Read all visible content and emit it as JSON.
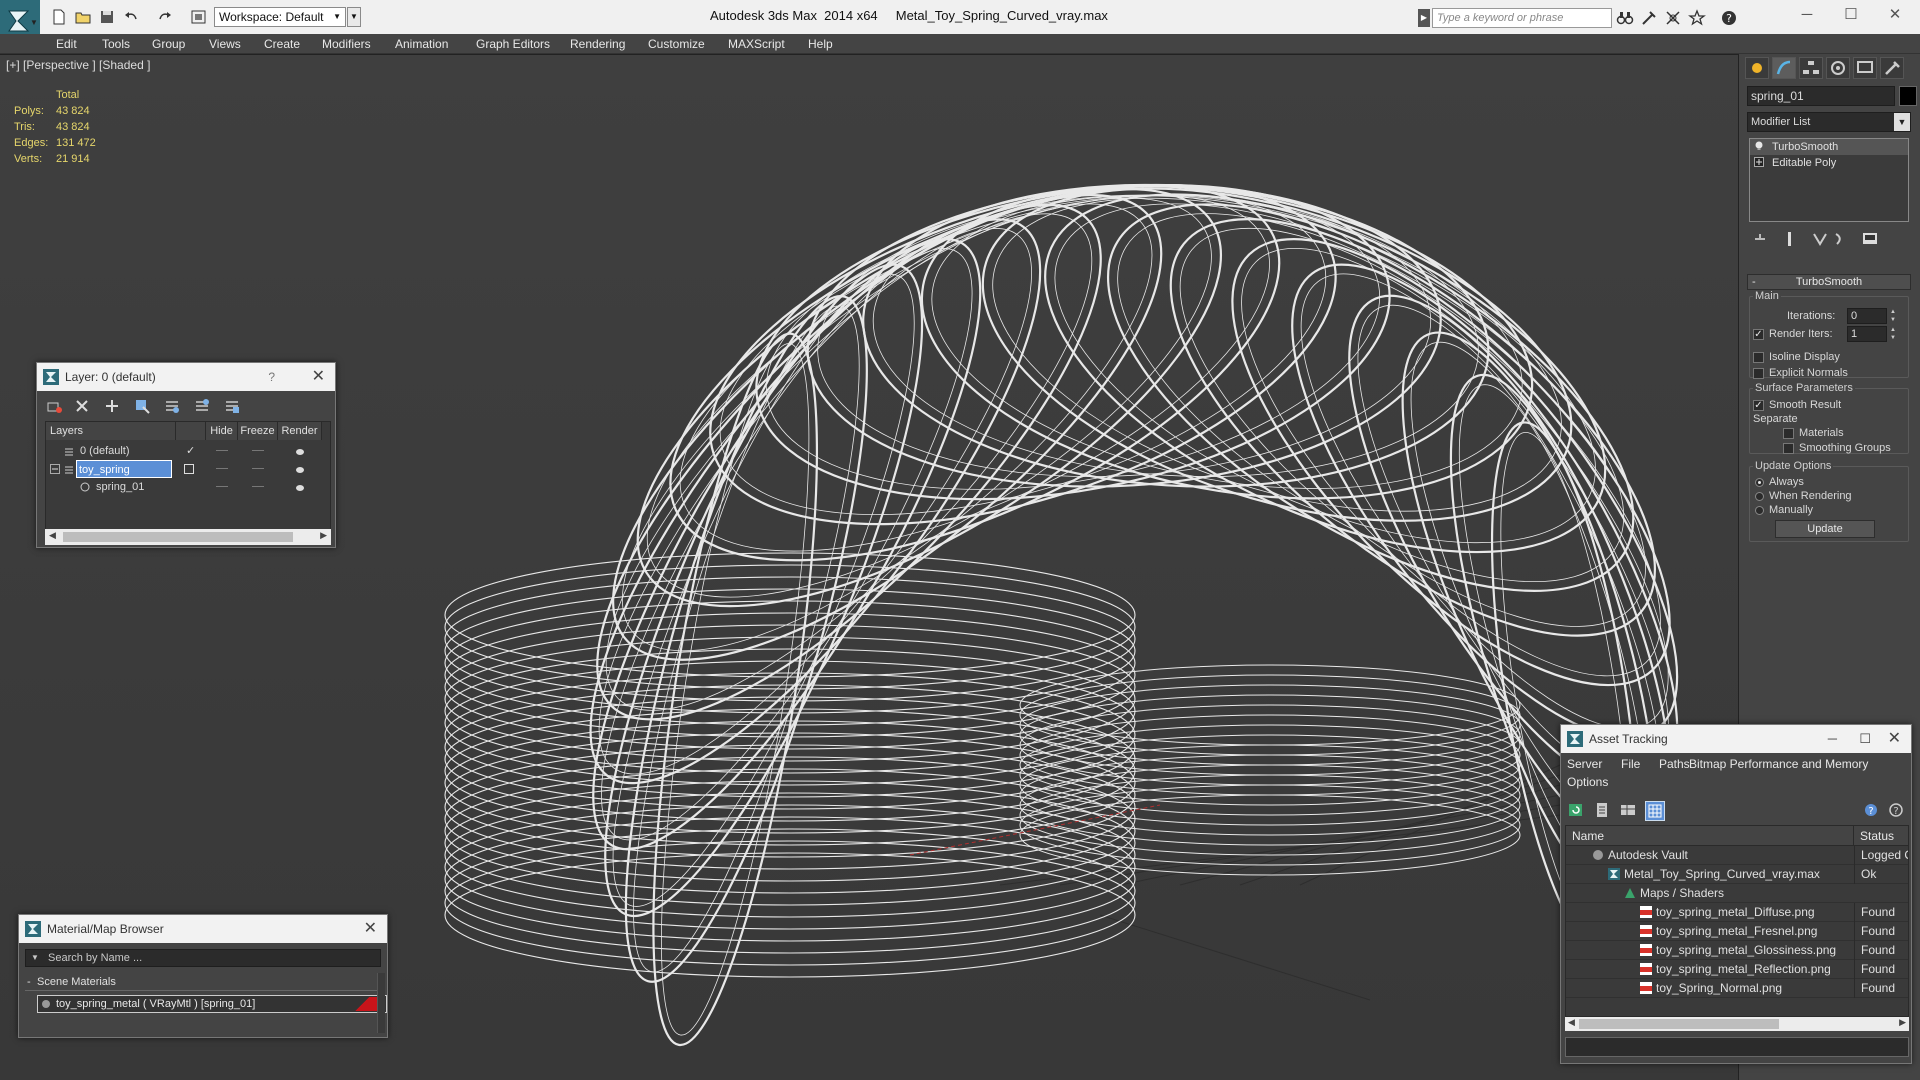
{
  "titlebar": {
    "workspace": "Workspace: Default",
    "app_name": "Autodesk 3ds Max  2014 x64",
    "file_name": "Metal_Toy_Spring_Curved_vray.max",
    "search_placeholder": "Type a keyword or phrase"
  },
  "menu": [
    "Edit",
    "Tools",
    "Group",
    "Views",
    "Create",
    "Modifiers",
    "Animation",
    "Graph Editors",
    "Rendering",
    "Customize",
    "MAXScript",
    "Help"
  ],
  "viewport": {
    "label": "[+] [Perspective ] [Shaded ]",
    "stats": {
      "header": "Total",
      "rows": [
        {
          "label": "Polys:",
          "value": "43 824"
        },
        {
          "label": "Tris:",
          "value": "43 824"
        },
        {
          "label": "Edges:",
          "value": "131 472"
        },
        {
          "label": "Verts:",
          "value": "21 914"
        }
      ]
    }
  },
  "command_panel": {
    "object_name": "spring_01",
    "modifier_list": "Modifier List",
    "stack": [
      "TurboSmooth",
      "Editable Poly"
    ],
    "turbosmooth": {
      "title": "TurboSmooth",
      "main_group": "Main",
      "iterations_label": "Iterations:",
      "iterations_value": "0",
      "render_iters_label": "Render Iters:",
      "render_iters_value": "1",
      "isoline_label": "Isoline Display",
      "explicit_normals_label": "Explicit Normals",
      "surface_group": "Surface Parameters",
      "smooth_result_label": "Smooth Result",
      "separate_label": "Separate",
      "materials_label": "Materials",
      "smoothing_groups_label": "Smoothing Groups",
      "update_group": "Update Options",
      "always_label": "Always",
      "when_rendering_label": "When Rendering",
      "manually_label": "Manually",
      "update_button": "Update"
    }
  },
  "layer_dialog": {
    "title": "Layer: 0 (default)",
    "help": "?",
    "columns": [
      "Layers",
      "Hide",
      "Freeze",
      "Render"
    ],
    "rows": [
      "0 (default)",
      "toy_spring",
      "spring_01"
    ]
  },
  "material_browser": {
    "title": "Material/Map Browser",
    "search_placeholder": "Search by Name ...",
    "group": "Scene Materials",
    "item": "toy_spring_metal  ( VRayMtl ) [spring_01]"
  },
  "asset_tracking": {
    "title": "Asset Tracking",
    "menu": [
      "Server",
      "File",
      "Paths",
      "Bitmap Performance and Memory",
      "Options"
    ],
    "columns": [
      "Name",
      "Status"
    ],
    "rows": [
      {
        "name": "Autodesk Vault",
        "status": "Logged Ou"
      },
      {
        "name": "Metal_Toy_Spring_Curved_vray.max",
        "status": "Ok"
      },
      {
        "name": "Maps / Shaders",
        "status": ""
      },
      {
        "name": "toy_spring_metal_Diffuse.png",
        "status": "Found"
      },
      {
        "name": "toy_spring_metal_Fresnel.png",
        "status": "Found"
      },
      {
        "name": "toy_spring_metal_Glossiness.png",
        "status": "Found"
      },
      {
        "name": "toy_spring_metal_Reflection.png",
        "status": "Found"
      },
      {
        "name": "toy_Spring_Normal.png",
        "status": "Found"
      }
    ]
  },
  "colors": {
    "ui_dark": "#444444",
    "viewport_bg": "#3b3b3b",
    "stats_yellow": "#e6d66b",
    "selection_blue": "#5b8fd6",
    "material_red": "#c8141a"
  }
}
